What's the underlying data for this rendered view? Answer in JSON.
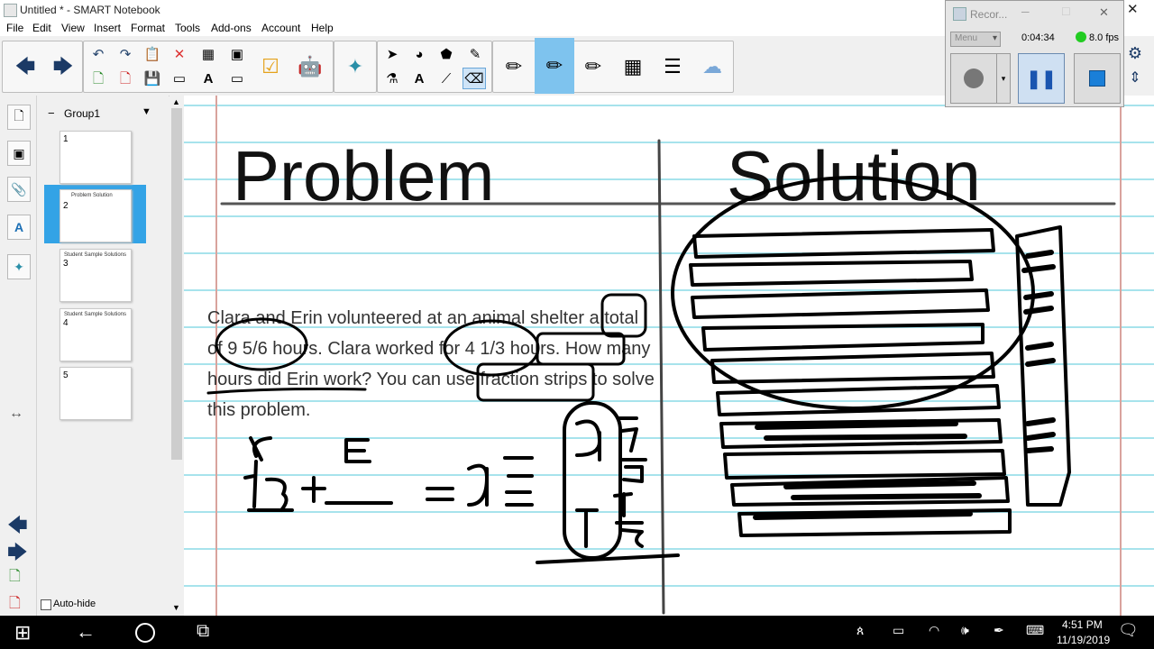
{
  "window": {
    "title": "Untitled * - SMART Notebook",
    "close_glyph": "✕"
  },
  "menu": [
    "File",
    "Edit",
    "View",
    "Insert",
    "Format",
    "Tools",
    "Add-ons",
    "Account",
    "Help"
  ],
  "toolbar": {
    "icons": [
      "back-arrow-icon",
      "forward-arrow-icon",
      "undo-icon",
      "redo-icon",
      "paste-icon",
      "delete-icon",
      "table-icon",
      "screen-capture-icon",
      "add-page-icon",
      "remove-page-icon",
      "save-icon",
      "screen-shade-icon",
      "spell-check-icon",
      "full-screen-icon",
      "response-icon",
      "addons-icon",
      "lab-activity-icon",
      "select-icon",
      "shapes-icon",
      "fill-icon",
      "pen-icon",
      "properties-icon",
      "text-icon",
      "line-icon",
      "eraser-icon",
      "highlighter-icon",
      "pen-active-icon",
      "magic-pen-icon",
      "color-icon",
      "line-width-icon",
      "stamp-icon"
    ]
  },
  "recorder": {
    "title": "Recor...",
    "menu_label": "Menu",
    "time": "0:04:34",
    "fps": "8.0 fps"
  },
  "sorter": {
    "group": "Group1",
    "pages": [
      {
        "num": "1",
        "text": ""
      },
      {
        "num": "2",
        "text": "Problem  Solution"
      },
      {
        "num": "3",
        "text": "Student Sample Solutions"
      },
      {
        "num": "4",
        "text": "Student Sample Solutions"
      },
      {
        "num": "5",
        "text": ""
      }
    ],
    "autohide": "Auto-hide"
  },
  "page": {
    "problem_title": "Problem",
    "solution_title": "Solution",
    "problem_text": "Clara and Erin volunteered at an animal shelter a total of 9 5/6 hours. Clara worked for 4 1/3 hours. How many hours did Erin work? You can use fraction strips to solve this problem."
  },
  "taskbar": {
    "time": "4:51 PM",
    "date": "11/19/2019"
  }
}
